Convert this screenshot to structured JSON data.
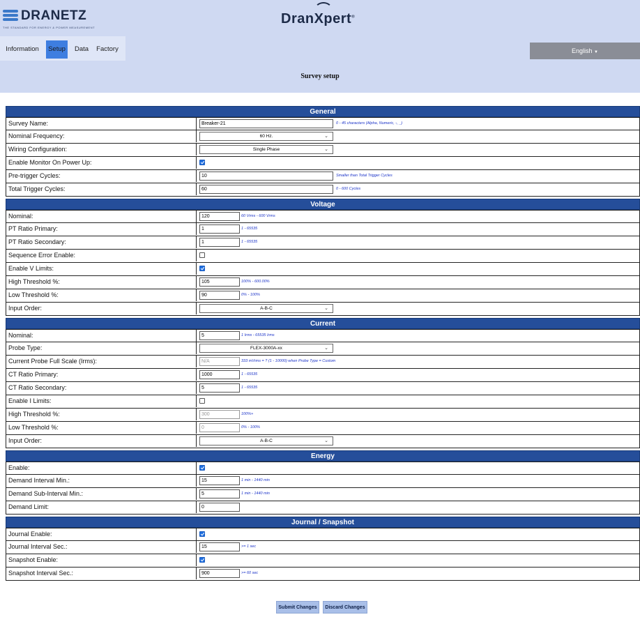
{
  "brand": {
    "name": "DRANETZ",
    "tagline": "THE STANDARD FOR ENERGY & POWER MEASUREMENT",
    "product": "DranXpert"
  },
  "nav": {
    "tabs": [
      "Information",
      "Setup",
      "Data",
      "Factory"
    ],
    "active": "Setup",
    "language": "English"
  },
  "page_title": "Survey setup",
  "sections": {
    "general": {
      "title": "General",
      "survey_name": {
        "label": "Survey Name:",
        "value": "Breaker-21",
        "hint": "0 - 45 characters (Alpha, Numeric, -, _)"
      },
      "nominal_frequency": {
        "label": "Nominal Frequency:",
        "value": "60 Hz."
      },
      "wiring": {
        "label": "Wiring Configuration:",
        "value": "Single Phase"
      },
      "enable_monitor": {
        "label": "Enable Monitor On Power Up:",
        "checked": true
      },
      "pretrigger": {
        "label": "Pre-trigger Cycles:",
        "value": "10",
        "hint": "Smaller than Total Trigger Cycles"
      },
      "total_trigger": {
        "label": "Total Trigger Cycles:",
        "value": "60",
        "hint": "0 - 600 Cycles"
      }
    },
    "voltage": {
      "title": "Voltage",
      "nominal": {
        "label": "Nominal:",
        "value": "120",
        "hint": "60 Vrms - 600 Vrms"
      },
      "pt_primary": {
        "label": "PT Ratio Primary:",
        "value": "1",
        "hint": "1 - 65535"
      },
      "pt_secondary": {
        "label": "PT Ratio Secondary:",
        "value": "1",
        "hint": "1 - 65535"
      },
      "seq_error": {
        "label": "Sequence Error Enable:",
        "checked": false
      },
      "enable_limits": {
        "label": "Enable V Limits:",
        "checked": true
      },
      "high_threshold": {
        "label": "High Threshold %:",
        "value": "105",
        "hint": "100% - 600.00%"
      },
      "low_threshold": {
        "label": "Low Threshold %:",
        "value": "90",
        "hint": "0% - 100%"
      },
      "input_order": {
        "label": "Input Order:",
        "value": "A-B-C"
      }
    },
    "current": {
      "title": "Current",
      "nominal": {
        "label": "Nominal:",
        "value": "5",
        "hint": "1 Irms - 65535 Irms"
      },
      "probe_type": {
        "label": "Probe Type:",
        "value": "FLEX-3000A-xx"
      },
      "probe_full_scale": {
        "label": "Current Probe Full Scale (Irms):",
        "value": "N/A",
        "hint": "333 mVrms = ? (1 - 10000) when Probe Type = Custom"
      },
      "ct_primary": {
        "label": "CT Ratio Primary:",
        "value": "1000",
        "hint": "1 - 65535"
      },
      "ct_secondary": {
        "label": "CT Ratio Secondary:",
        "value": "5",
        "hint": "1 - 65535"
      },
      "enable_limits": {
        "label": "Enable I Limits:",
        "checked": false
      },
      "high_threshold": {
        "label": "High Threshold %:",
        "value": "300",
        "hint": "100%+"
      },
      "low_threshold": {
        "label": "Low Threshold %:",
        "value": "0",
        "hint": "0% - 100%"
      },
      "input_order": {
        "label": "Input Order:",
        "value": "A-B-C"
      }
    },
    "energy": {
      "title": "Energy",
      "enable": {
        "label": "Enable:",
        "checked": true
      },
      "demand_interval": {
        "label": "Demand Interval Min.:",
        "value": "15",
        "hint": "1 min - 1440 min"
      },
      "demand_sub": {
        "label": "Demand Sub-Interval Min.:",
        "value": "5",
        "hint": "1 min - 1440 min"
      },
      "demand_limit": {
        "label": "Demand Limit:",
        "value": "0"
      }
    },
    "journal": {
      "title": "Journal / Snapshot",
      "journal_enable": {
        "label": "Journal Enable:",
        "checked": true
      },
      "journal_interval": {
        "label": "Journal Interval Sec.:",
        "value": "15",
        "hint": ">= 1 sec"
      },
      "snapshot_enable": {
        "label": "Snapshot Enable:",
        "checked": true
      },
      "snapshot_interval": {
        "label": "Snapshot Interval Sec.:",
        "value": "900",
        "hint": ">= 60 sec"
      }
    }
  },
  "buttons": {
    "submit": "Submit Changes",
    "discard": "Discard Changes"
  }
}
